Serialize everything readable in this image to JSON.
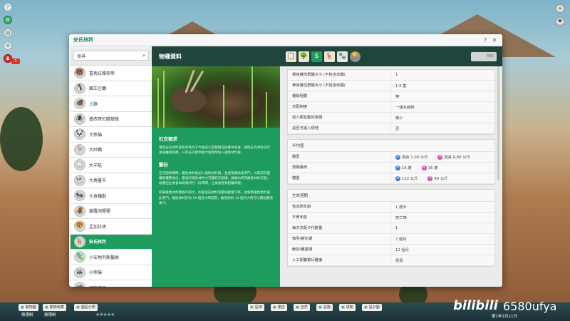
{
  "window": {
    "title": "安氏林羚",
    "help": "?",
    "close": "✕"
  },
  "search": {
    "placeholder": "搜尋"
  },
  "animals": [
    {
      "name": "喜馬拉雅棕熊",
      "icon": "🐻"
    },
    {
      "name": "國王企鵝",
      "icon": "🐧"
    },
    {
      "name": "土豚",
      "icon": "🐗"
    },
    {
      "name": "墨西哥紅膝蜘蛛",
      "icon": "🕷"
    },
    {
      "name": "大熊貓",
      "icon": "🐼"
    },
    {
      "name": "大紅鸛",
      "icon": "🦩"
    },
    {
      "name": "大羊駝",
      "icon": "🦙"
    },
    {
      "name": "大角盤羊",
      "icon": "🐏"
    },
    {
      "name": "大食蟻獸",
      "icon": "🐜"
    },
    {
      "name": "婆羅洲猩猩",
      "icon": "🦧"
    },
    {
      "name": "孟加拉虎",
      "icon": "🐯"
    },
    {
      "name": "安氏林羚",
      "icon": "🦌"
    },
    {
      "name": "小安地列斯鬣蜥",
      "icon": "🦎"
    },
    {
      "name": "小熊貓",
      "icon": "🦝"
    },
    {
      "name": "印度河馬",
      "icon": "🦛"
    }
  ],
  "selected_index": 11,
  "header": {
    "title": "物種資料",
    "user_btn": "移除"
  },
  "tabs": [
    {
      "name": "info-tab",
      "glyph": "📋"
    },
    {
      "name": "habitat-tab",
      "glyph": "🌳"
    },
    {
      "name": "money-tab",
      "glyph": "$"
    },
    {
      "name": "social-tab",
      "glyph": "🦌"
    },
    {
      "name": "enrichment-tab",
      "glyph": "🐾"
    },
    {
      "name": "trophy-tab",
      "glyph": "🏆"
    }
  ],
  "panel": {
    "social_heading": "社交需求",
    "social_text": "雄性安氏林羚會和同性的子代組成小型獸群在樹叢中覓食，雌性安氏林羚成年後會離群結群，只有在交配季節才會暫時加入雄性林羚群。",
    "breeding_heading": "繁衍",
    "breeding_text": "在交配季節時，雄性林羚會加入雌性林羚群，並展現頭與角爭鬥，以取得交配權與優勢地位，最強的雄性林羚才可獲取交配權，與群內所有雌性林羚交配。幼體出生後會與母親同行一段時間，之後會逐漸脫離母親。",
    "extra_text": "如果雌性林羚獸群不夠大，則會造成林羚的繁殖數量下降，並導致雄性林羚彼此爭鬥。雄性林羚於約 18 個月大時成熟，雌性則約 14 個月大時可以開始繁殖後代。"
  },
  "sections": [
    {
      "title": "",
      "rows": [
        {
          "k": "單身雄性群體大小 (不包含幼體)",
          "v": "1"
        },
        {
          "k": "單身雄性群體大小 (不包含幼體)",
          "v": "1-5 隻"
        },
        {
          "k": "優勢個體",
          "v": "無"
        },
        {
          "k": "交配制度",
          "v": "一雄多雌制"
        },
        {
          "k": "與人類互動的意願",
          "v": "微小"
        },
        {
          "k": "是否可進入棲地",
          "v": "否"
        }
      ]
    },
    {
      "title": "半均值",
      "rows": [
        {
          "k": "體型",
          "male": "真高 1.00 公尺",
          "female": "真高 0.80 公尺"
        },
        {
          "k": "預期壽命",
          "male": "16 歲",
          "female": "16 歲"
        },
        {
          "k": "體重",
          "male": "112 公斤",
          "female": "64 公斤"
        }
      ]
    },
    {
      "title": "生命週期",
      "rows": [
        {
          "k": "性成熟年齡",
          "v": "1 歲半"
        },
        {
          "k": "不育年齡",
          "v": "死亡時"
        },
        {
          "k": "每次交配子代數量",
          "v": "1"
        },
        {
          "k": "懷孕/孵化期",
          "v": "7 個月"
        },
        {
          "k": "斷奶/離巢期",
          "v": "12 個月"
        },
        {
          "k": "人工飼養繁衍難度",
          "v": "極易"
        }
      ]
    }
  ],
  "toolbar": {
    "left_buttons": [
      "動物園",
      "動物收藏",
      "園區分類"
    ],
    "center_buttons": [
      "區域",
      "建造",
      "自然",
      "設施",
      "運輸",
      "設計圖"
    ],
    "budget1": "無限制",
    "budget2": "無限制",
    "date": "第1年1月11日",
    "watermark1": "bilibili",
    "watermark2": "6580ufya"
  }
}
